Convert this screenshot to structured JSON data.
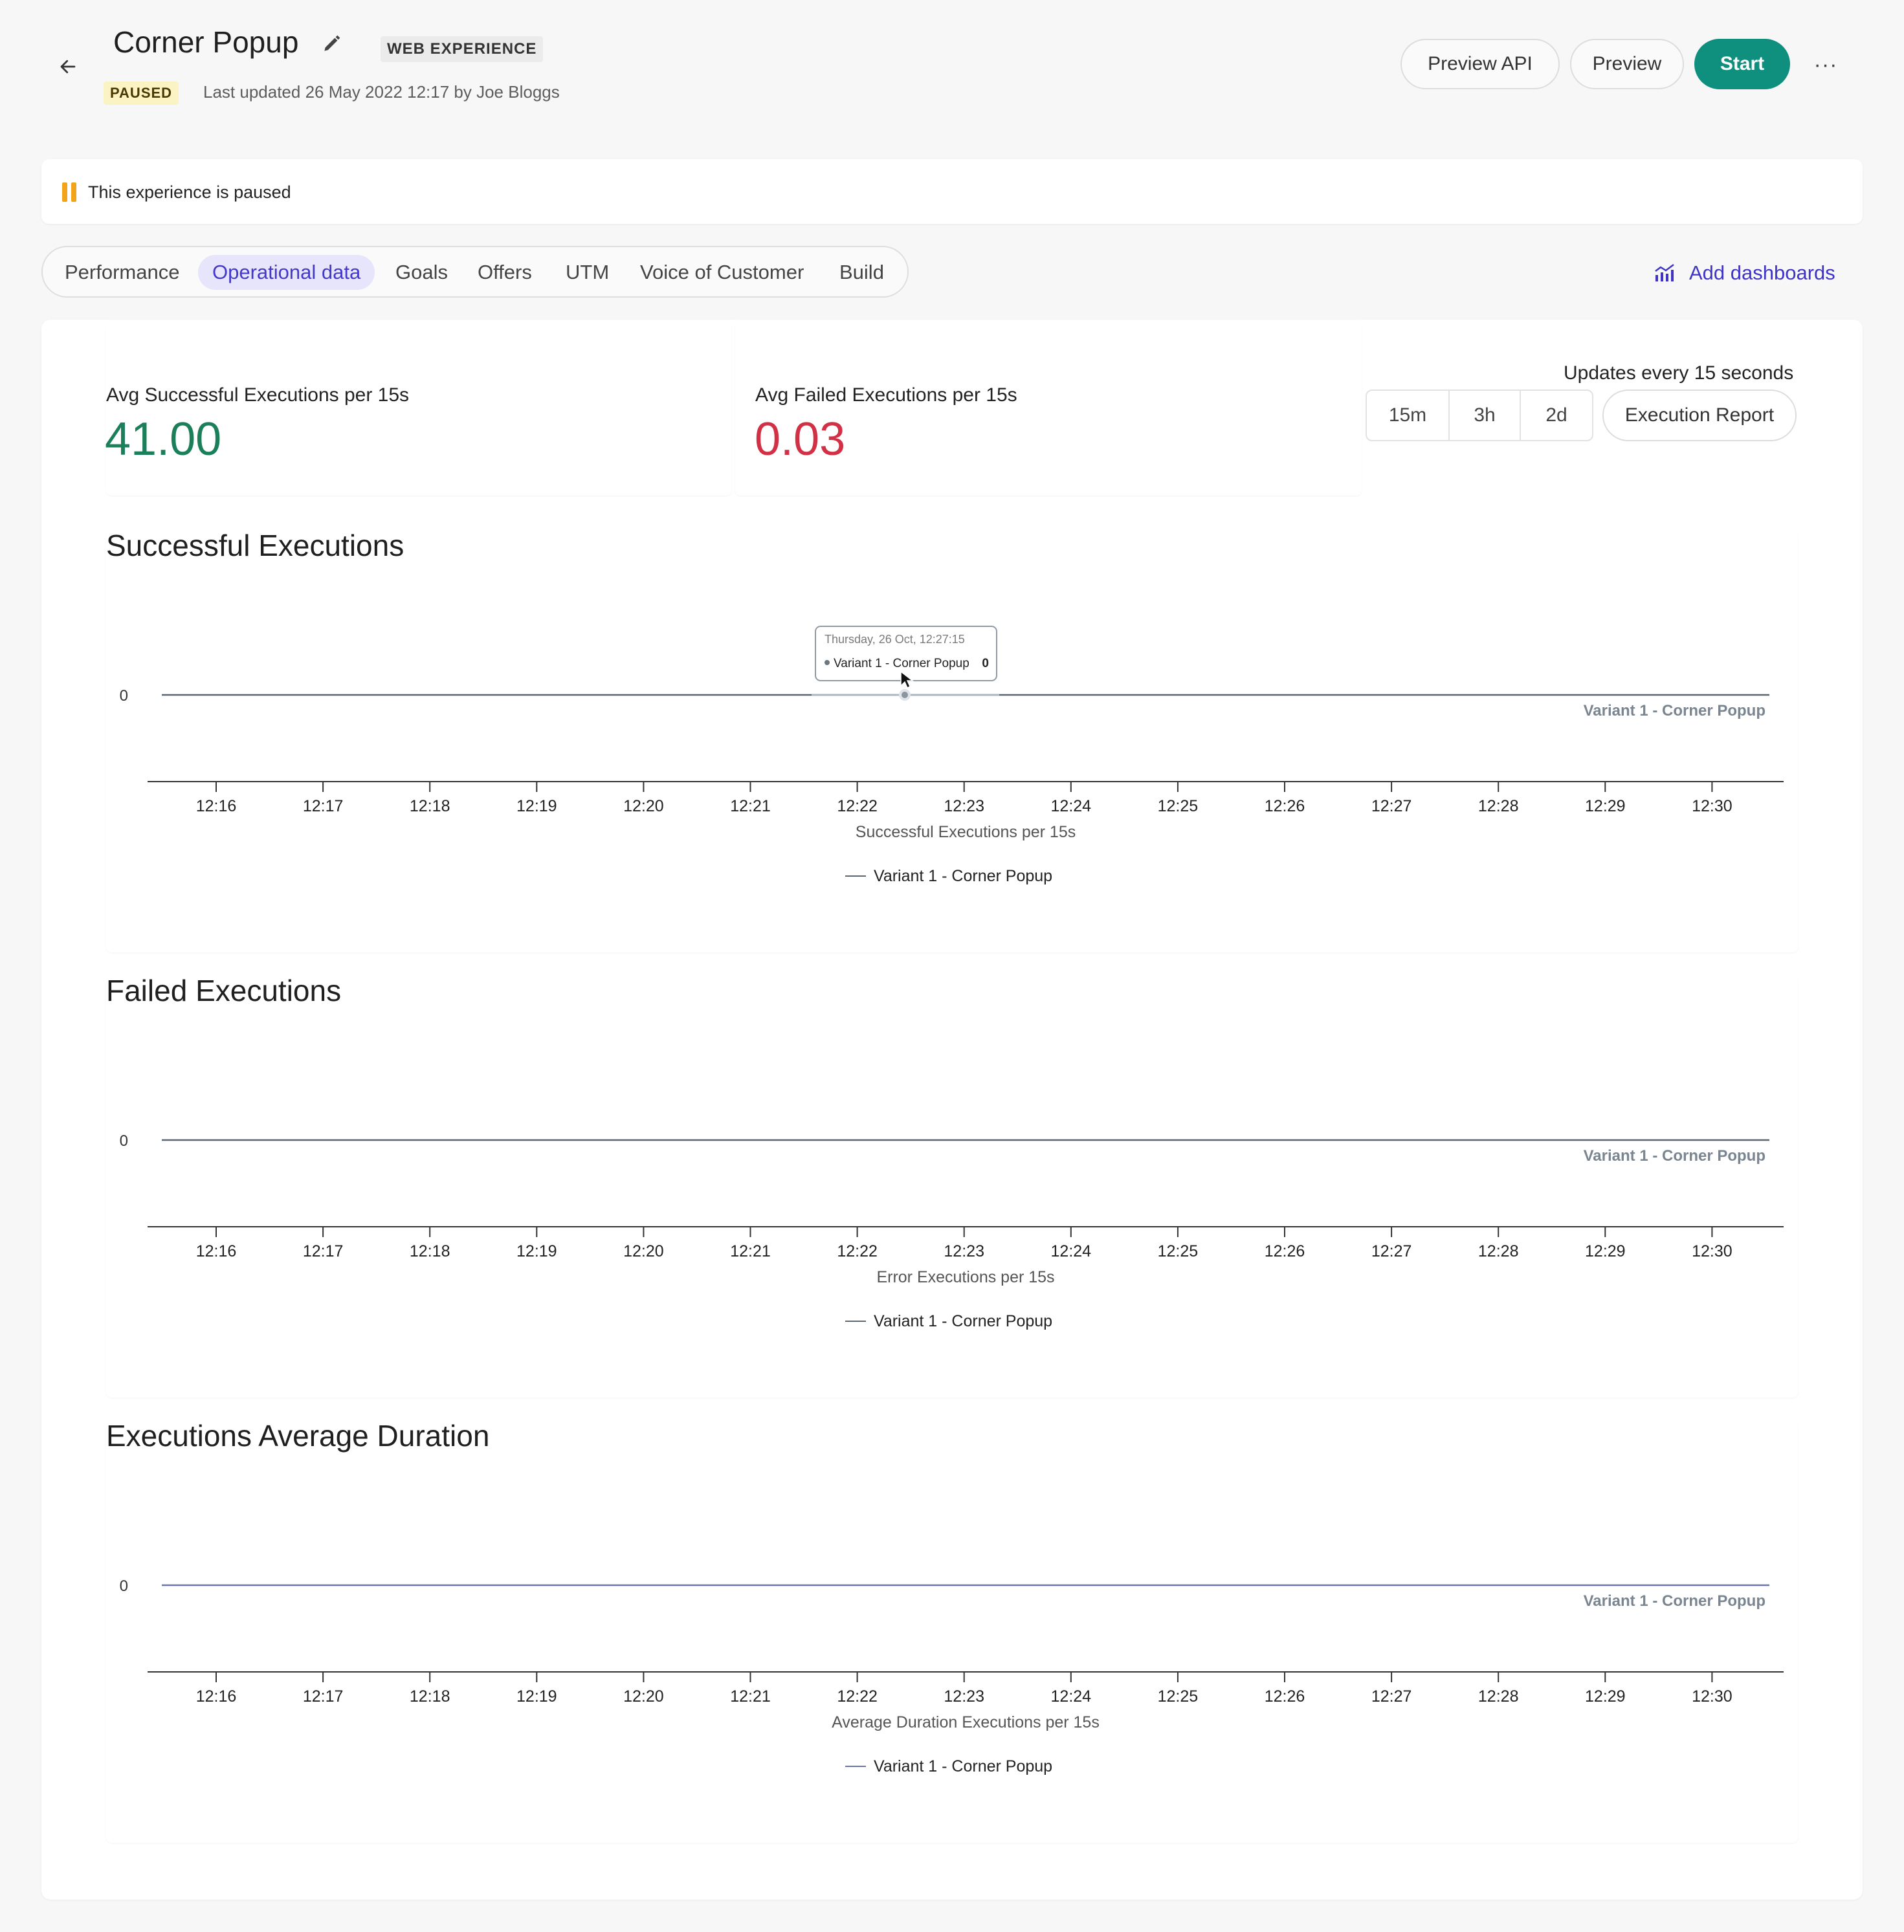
{
  "header": {
    "title": "Corner Popup",
    "type_badge": "WEB EXPERIENCE",
    "status_badge": "PAUSED",
    "last_updated": "Last updated 26 May 2022 12:17 by Joe Bloggs",
    "buttons": {
      "preview_api": "Preview API",
      "preview": "Preview",
      "start": "Start",
      "more": "···"
    },
    "icons": {
      "back": "arrow-left-icon",
      "edit": "pencil-icon",
      "more": "more-horizontal-icon"
    }
  },
  "banner": {
    "text": "This experience is paused",
    "icon": "pause-icon"
  },
  "tabs": [
    {
      "label": "Performance",
      "active": false
    },
    {
      "label": "Operational data",
      "active": true
    },
    {
      "label": "Goals",
      "active": false
    },
    {
      "label": "Offers",
      "active": false
    },
    {
      "label": "UTM",
      "active": false
    },
    {
      "label": "Voice of Customer",
      "active": false
    },
    {
      "label": "Build",
      "active": false
    }
  ],
  "add_dashboards": {
    "label": "Add dashboards",
    "icon": "chart-icon"
  },
  "stats": {
    "successful": {
      "label": "Avg Successful Executions per 15s",
      "value": "41.00",
      "color": "#1b7f5a"
    },
    "failed": {
      "label": "Avg Failed Executions per 15s",
      "value": "0.03",
      "color": "#d23045"
    }
  },
  "controls": {
    "updates": "Updates every 15 seconds",
    "ranges": [
      "15m",
      "3h",
      "2d"
    ],
    "execution_report": "Execution Report"
  },
  "tooltip": {
    "date": "Thursday, 26 Oct, 12:27:15",
    "series": "Variant 1 - Corner Popup",
    "value": "0"
  },
  "chart_data": [
    {
      "type": "line",
      "title": "Successful Executions",
      "xlabel": "Successful Executions per 15s",
      "ylabel": "",
      "y_ticks": [
        "0"
      ],
      "categories": [
        "12:16",
        "12:17",
        "12:18",
        "12:19",
        "12:20",
        "12:21",
        "12:22",
        "12:23",
        "12:24",
        "12:25",
        "12:26",
        "12:27",
        "12:28",
        "12:29",
        "12:30"
      ],
      "series": [
        {
          "name": "Variant 1 - Corner Popup",
          "values": [
            0,
            0,
            0,
            0,
            0,
            0,
            0,
            0,
            0,
            0,
            0,
            0,
            0,
            0,
            0
          ]
        }
      ],
      "series_end_label": "Variant 1 - Corner Popup",
      "legend": "bottom",
      "line_color": "#5b6770"
    },
    {
      "type": "line",
      "title": "Failed Executions",
      "xlabel": "Error Executions per 15s",
      "ylabel": "",
      "y_ticks": [
        "0"
      ],
      "categories": [
        "12:16",
        "12:17",
        "12:18",
        "12:19",
        "12:20",
        "12:21",
        "12:22",
        "12:23",
        "12:24",
        "12:25",
        "12:26",
        "12:27",
        "12:28",
        "12:29",
        "12:30"
      ],
      "series": [
        {
          "name": "Variant 1 - Corner Popup",
          "values": [
            0,
            0,
            0,
            0,
            0,
            0,
            0,
            0,
            0,
            0,
            0,
            0,
            0,
            0,
            0
          ]
        }
      ],
      "series_end_label": "Variant 1 - Corner Popup",
      "legend": "bottom",
      "line_color": "#5b6770"
    },
    {
      "type": "line",
      "title": "Executions Average Duration",
      "xlabel": "Average Duration Executions per 15s",
      "ylabel": "",
      "y_ticks": [
        "0"
      ],
      "categories": [
        "12:16",
        "12:17",
        "12:18",
        "12:19",
        "12:20",
        "12:21",
        "12:22",
        "12:23",
        "12:24",
        "12:25",
        "12:26",
        "12:27",
        "12:28",
        "12:29",
        "12:30"
      ],
      "series": [
        {
          "name": "Variant 1 - Corner Popup",
          "values": [
            0,
            0,
            0,
            0,
            0,
            0,
            0,
            0,
            0,
            0,
            0,
            0,
            0,
            0,
            0
          ]
        }
      ],
      "series_end_label": "Variant 1 - Corner Popup",
      "legend": "bottom",
      "line_color": "#6a74a8"
    }
  ]
}
